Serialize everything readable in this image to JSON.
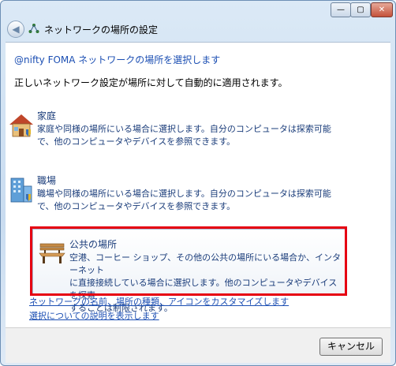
{
  "window": {
    "title": "ネットワークの場所の設定",
    "controls": {
      "minimize": "—",
      "maximize": "▢",
      "close": "✕"
    }
  },
  "content": {
    "heading": "@nifty FOMA ネットワークの場所を選択します",
    "subtitle": "正しいネットワーク設定が場所に対して自動的に適用されます。",
    "options": [
      {
        "title": "家庭",
        "desc1": "家庭や同様の場所にいる場合に選択します。自分のコンピュータは探索可能",
        "desc2": "で、他のコンピュータやデバイスを参照できます。",
        "icon": "house-icon"
      },
      {
        "title": "職場",
        "desc1": "職場や同様の場所にいる場合に選択します。自分のコンピュータは探索可能",
        "desc2": "で、他のコンピュータやデバイスを参照できます。",
        "icon": "office-building-icon"
      },
      {
        "title": "公共の場所",
        "desc1": "空港、コーヒー ショップ、その他の公共の場所にいる場合か、インターネット",
        "desc2": "に直接接続している場合に選択します。他のコンピュータやデバイスを探索",
        "desc3": "することは制限されます。",
        "icon": "park-bench-icon"
      }
    ],
    "links": {
      "customize": "ネットワークの名前、場所の種類、アイコンをカスタマイズします",
      "help": "選択についての説明を表示します"
    }
  },
  "footer": {
    "cancel_label": "キャンセル"
  },
  "colors": {
    "highlight": "#e60012",
    "link": "#1c4fb3"
  }
}
